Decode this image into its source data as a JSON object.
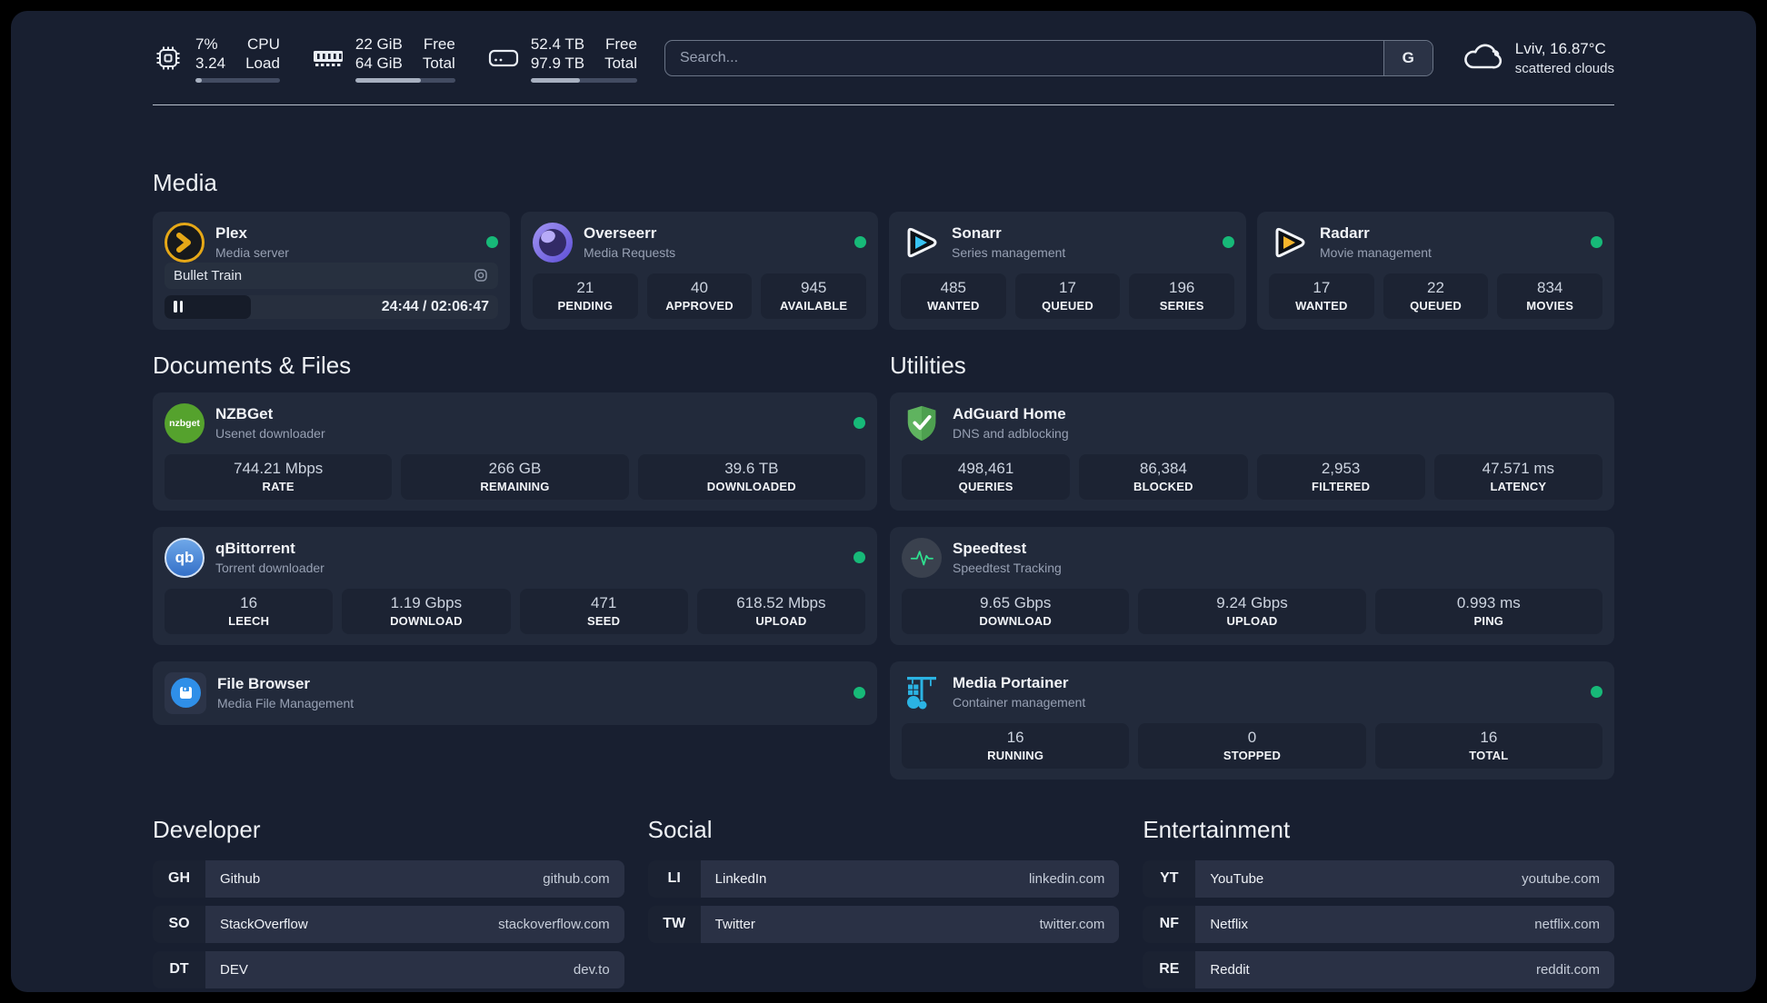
{
  "header": {
    "system_stats": [
      {
        "icon": "cpu-icon",
        "values": [
          "7%",
          "3.24"
        ],
        "labels": [
          "CPU",
          "Load"
        ],
        "progress_percent": 7
      },
      {
        "icon": "ram-icon",
        "values": [
          "22 GiB",
          "64 GiB"
        ],
        "labels": [
          "Free",
          "Total"
        ],
        "progress_percent": 66
      },
      {
        "icon": "disk-icon",
        "values": [
          "52.4 TB",
          "97.9 TB"
        ],
        "labels": [
          "Free",
          "Total"
        ],
        "progress_percent": 46
      }
    ],
    "search": {
      "placeholder": "Search...",
      "engine_button": "G"
    },
    "weather": {
      "location": "Lviv, 16.87°C",
      "condition": "scattered clouds"
    }
  },
  "sections": {
    "media": "Media",
    "documents": "Documents & Files",
    "utilities": "Utilities",
    "developer": "Developer",
    "social": "Social",
    "entertainment": "Entertainment"
  },
  "apps": {
    "plex": {
      "name": "Plex",
      "description": "Media server",
      "online": true,
      "now_playing": {
        "title": "Bullet Train",
        "state": "paused",
        "time": "24:44 / 02:06:47",
        "progress_percent": 26
      }
    },
    "overseerr": {
      "name": "Overseerr",
      "description": "Media Requests",
      "online": true,
      "stats": [
        {
          "value": "21",
          "label": "PENDING"
        },
        {
          "value": "40",
          "label": "APPROVED"
        },
        {
          "value": "945",
          "label": "AVAILABLE"
        }
      ]
    },
    "sonarr": {
      "name": "Sonarr",
      "description": "Series management",
      "online": true,
      "stats": [
        {
          "value": "485",
          "label": "WANTED"
        },
        {
          "value": "17",
          "label": "QUEUED"
        },
        {
          "value": "196",
          "label": "SERIES"
        }
      ]
    },
    "radarr": {
      "name": "Radarr",
      "description": "Movie management",
      "online": true,
      "stats": [
        {
          "value": "17",
          "label": "WANTED"
        },
        {
          "value": "22",
          "label": "QUEUED"
        },
        {
          "value": "834",
          "label": "MOVIES"
        }
      ]
    },
    "nzbget": {
      "name": "NZBGet",
      "description": "Usenet downloader",
      "online": true,
      "icon_text": "nzbget",
      "stats": [
        {
          "value": "744.21 Mbps",
          "label": "RATE"
        },
        {
          "value": "266 GB",
          "label": "REMAINING"
        },
        {
          "value": "39.6 TB",
          "label": "DOWNLOADED"
        }
      ]
    },
    "qbittorrent": {
      "name": "qBittorrent",
      "description": "Torrent downloader",
      "online": true,
      "icon_text": "qb",
      "stats": [
        {
          "value": "16",
          "label": "LEECH"
        },
        {
          "value": "1.19 Gbps",
          "label": "DOWNLOAD"
        },
        {
          "value": "471",
          "label": "SEED"
        },
        {
          "value": "618.52 Mbps",
          "label": "UPLOAD"
        }
      ]
    },
    "filebrowser": {
      "name": "File Browser",
      "description": "Media File Management",
      "online": true
    },
    "adguard": {
      "name": "AdGuard Home",
      "description": "DNS and adblocking",
      "stats": [
        {
          "value": "498,461",
          "label": "QUERIES"
        },
        {
          "value": "86,384",
          "label": "BLOCKED"
        },
        {
          "value": "2,953",
          "label": "FILTERED"
        },
        {
          "value": "47.571 ms",
          "label": "LATENCY"
        }
      ]
    },
    "speedtest": {
      "name": "Speedtest",
      "description": "Speedtest Tracking",
      "stats": [
        {
          "value": "9.65 Gbps",
          "label": "DOWNLOAD"
        },
        {
          "value": "9.24 Gbps",
          "label": "UPLOAD"
        },
        {
          "value": "0.993 ms",
          "label": "PING"
        }
      ]
    },
    "portainer": {
      "name": "Media Portainer",
      "description": "Container management",
      "online": true,
      "stats": [
        {
          "value": "16",
          "label": "RUNNING"
        },
        {
          "value": "0",
          "label": "STOPPED"
        },
        {
          "value": "16",
          "label": "TOTAL"
        }
      ]
    }
  },
  "links": {
    "developer": [
      {
        "abbr": "GH",
        "name": "Github",
        "domain": "github.com"
      },
      {
        "abbr": "SO",
        "name": "StackOverflow",
        "domain": "stackoverflow.com"
      },
      {
        "abbr": "DT",
        "name": "DEV",
        "domain": "dev.to"
      }
    ],
    "social": [
      {
        "abbr": "LI",
        "name": "LinkedIn",
        "domain": "linkedin.com"
      },
      {
        "abbr": "TW",
        "name": "Twitter",
        "domain": "twitter.com"
      }
    ],
    "entertainment": [
      {
        "abbr": "YT",
        "name": "YouTube",
        "domain": "youtube.com"
      },
      {
        "abbr": "NF",
        "name": "Netflix",
        "domain": "netflix.com"
      },
      {
        "abbr": "RE",
        "name": "Reddit",
        "domain": "reddit.com"
      }
    ]
  },
  "colors": {
    "status_online": "#17b978",
    "plex_accent": "#e6a817"
  }
}
